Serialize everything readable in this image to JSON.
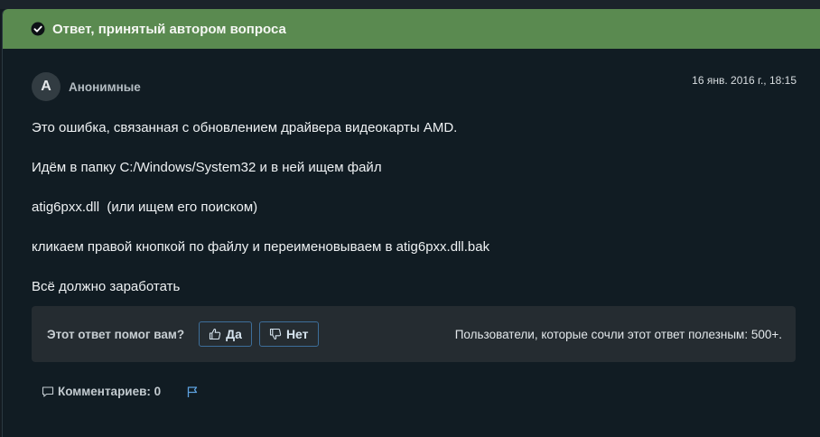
{
  "banner": {
    "text": "Ответ, принятый автором вопроса",
    "icon": "check-circle-icon",
    "color": "#5a8a50"
  },
  "author": {
    "initial": "A",
    "name": "Анонимные"
  },
  "timestamp": "16 янв. 2016 г., 18:15",
  "body": {
    "paragraphs": [
      "Это ошибка, связанная с обновлением драйвера видеокарты AMD.",
      "Идём в папку C:/Windows/System32 и в ней ищем файл",
      "atig6pxx.dll  (или ищем его поиском)",
      "кликаем правой кнопкой по файлу и переименовываем в atig6pxx.dll.bak",
      "Всё должно заработать"
    ]
  },
  "helpful": {
    "question": "Этот ответ помог вам?",
    "yes_label": "Да",
    "no_label": "Нет",
    "count_text": "Пользователи, которые сочли этот ответ полезным: 500+."
  },
  "footer": {
    "comments_label": "Комментариев: 0",
    "flag_icon": "flag-icon"
  }
}
